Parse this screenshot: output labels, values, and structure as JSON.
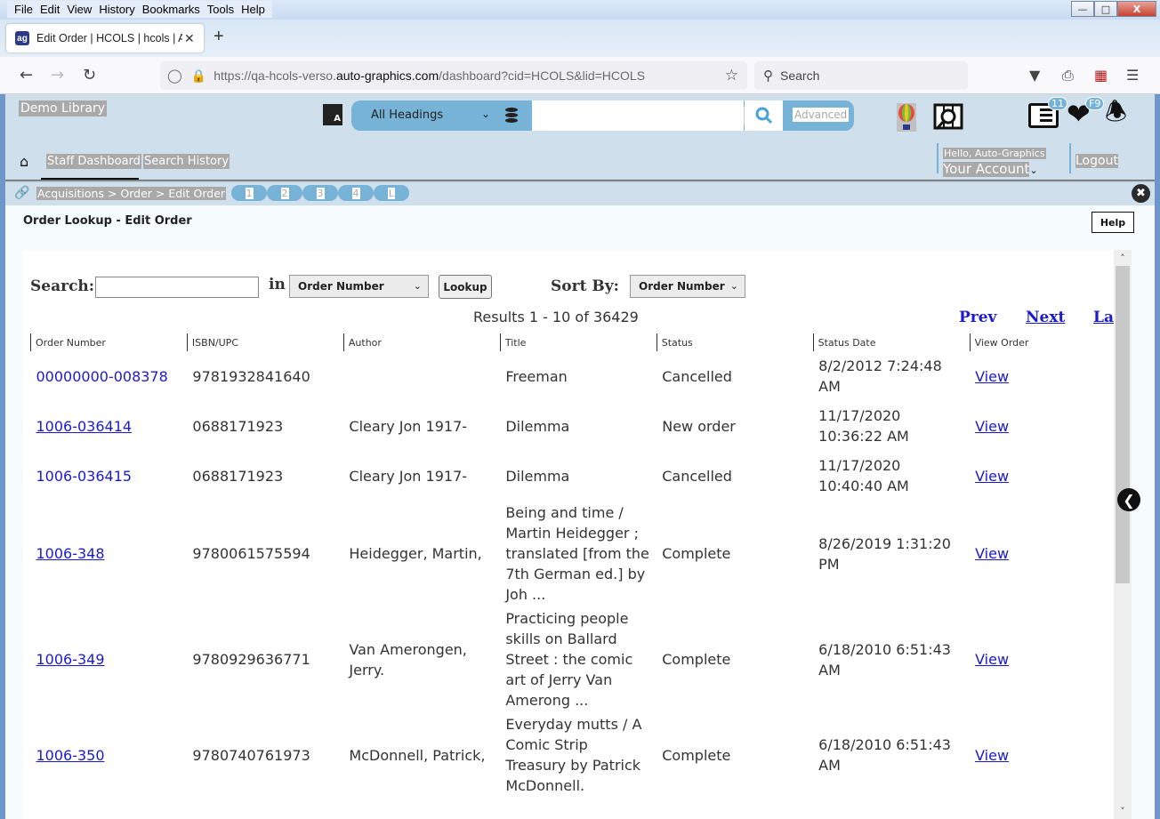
{
  "browser": {
    "menu": [
      "File",
      "Edit",
      "View",
      "History",
      "Bookmarks",
      "Tools",
      "Help"
    ],
    "tab_title": "Edit Order | HCOLS | hcols | Auto-Graphics",
    "url_prefix": "https://qa-hcols-verso.",
    "url_domain": "auto-graphics.com",
    "url_suffix": "/dashboard?cid=HCOLS&lid=HCOLS",
    "search_placeholder": "Search"
  },
  "header": {
    "library_name": "Demo Library",
    "search_scope": "All Headings",
    "search_value": "",
    "advanced_label": "Advanced",
    "list_badge": "11",
    "favorites_badge": "F9",
    "nav_tabs": [
      "Staff Dashboard",
      "Search History"
    ],
    "greeting": "Hello, Auto-Graphics",
    "account_label": "Your Account",
    "logout_label": "Logout"
  },
  "breadcrumb": {
    "path": "Acquisitions > Order > Edit Order",
    "pills": [
      "1",
      "2",
      "3",
      "4",
      "L"
    ]
  },
  "page": {
    "title": "Order Lookup - Edit Order",
    "help_label": "Help",
    "search_label": "Search:",
    "search_value": "",
    "in_label": "in",
    "search_field_option": "Order Number",
    "lookup_label": "Lookup",
    "sort_label": "Sort By:",
    "sort_option": "Order Number",
    "results_text": "Results 1 - 10 of 36429",
    "prev_label": "Prev",
    "next_label": "Next",
    "last_label": "Last"
  },
  "table": {
    "columns": [
      "Order Number",
      "ISBN/UPC",
      "Author",
      "Title",
      "Status",
      "Status Date",
      "View Order"
    ],
    "rows": [
      {
        "order": "00000000-008378",
        "isbn": "9781932841640",
        "author": "",
        "title": "Freeman",
        "status": "Cancelled",
        "date": "8/2/2012 7:24:48 AM",
        "view": "View"
      },
      {
        "order": "1006-036414",
        "isbn": "0688171923",
        "author": "Cleary Jon 1917-",
        "title": "Dilemma",
        "status": "New order",
        "date": "11/17/2020 10:36:22 AM",
        "view": "View"
      },
      {
        "order": "1006-036415",
        "isbn": "0688171923",
        "author": "Cleary Jon 1917-",
        "title": "Dilemma",
        "status": "Cancelled",
        "date": "11/17/2020 10:40:40 AM",
        "view": "View"
      },
      {
        "order": "1006-348",
        "isbn": "9780061575594",
        "author": "Heidegger, Martin,",
        "title": "Being and time / Martin Heidegger ; translated [from the 7th German ed.] by Joh ...",
        "status": "Complete",
        "date": "8/26/2019 1:31:20 PM",
        "view": "View"
      },
      {
        "order": "1006-349",
        "isbn": "9780929636771",
        "author": "Van Amerongen, Jerry.",
        "title": "Practicing people skills on Ballard Street : the comic art of Jerry Van Amerong ...",
        "status": "Complete",
        "date": "6/18/2010 6:51:43 AM",
        "view": "View"
      },
      {
        "order": "1006-350",
        "isbn": "9780740761973",
        "author": "McDonnell, Patrick,",
        "title": "Everyday mutts / A Comic Strip Treasury by Patrick McDonnell.",
        "status": "Complete",
        "date": "6/18/2010 6:51:43 AM",
        "view": "View"
      }
    ]
  }
}
